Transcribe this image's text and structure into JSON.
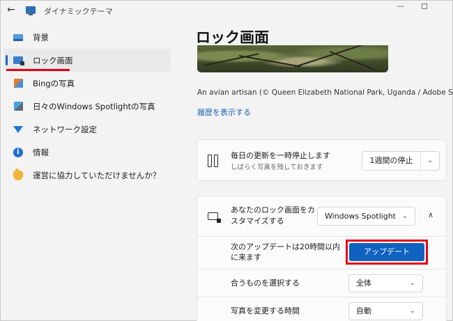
{
  "titlebar": {
    "back_glyph": "←",
    "title": "ダイナミックテーマ",
    "minimize_glyph": "—"
  },
  "sidebar": {
    "items": [
      {
        "label": "背景",
        "icon": "background-icon",
        "active": false
      },
      {
        "label": "ロック画面",
        "icon": "lock-screen-icon",
        "active": true
      },
      {
        "label": "Bingの写真",
        "icon": "bing-icon",
        "active": false
      },
      {
        "label": "日々のWindows Spotlightの写真",
        "icon": "spotlight-icon",
        "active": false
      },
      {
        "label": "ネットワーク設定",
        "icon": "wifi-icon",
        "active": false
      },
      {
        "label": "情報",
        "icon": "info-icon",
        "active": false
      },
      {
        "label": "運営に協力していただけませんか？",
        "icon": "help-icon",
        "active": false
      }
    ]
  },
  "main": {
    "title": "ロック画面",
    "credit": "An avian artisan (© Queen Elizabeth National Park, Uganda / Adobe Stock)",
    "history_link": "履歴を表示する",
    "pause_card": {
      "title": "毎日の更新を一時停止します",
      "subtitle": "しばらく写真を残しておきます",
      "select_value": "1週間の停止",
      "chevron": "⌄"
    },
    "customize_card": {
      "title": "あなたのロック画面をカスタマイズする",
      "select_value": "Windows Spotlight",
      "collapse_glyph": "∧",
      "rows": {
        "update_label": "次のアップデートは20時間以内に来ます",
        "update_button": "アップデート",
        "match_label": "合うものを選択する",
        "match_value": "全体",
        "change_label": "写真を変更する時間",
        "change_value": "自動"
      }
    }
  },
  "colors": {
    "accent": "#0f62c0",
    "highlight_red": "#e60012",
    "link": "#1a5fb4"
  }
}
